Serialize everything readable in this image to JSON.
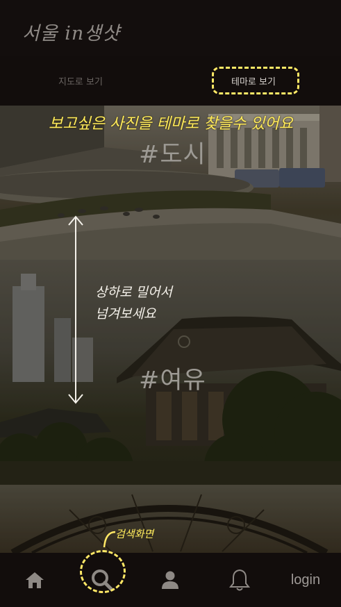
{
  "header": {
    "title": "서울 in생샷"
  },
  "tabs": [
    {
      "label": "지도로 보기",
      "active": false
    },
    {
      "label": "테마로 보기",
      "active": true
    }
  ],
  "themes": [
    {
      "hashtag": "#도시"
    },
    {
      "hashtag": "#여유"
    },
    {
      "hashtag": ""
    }
  ],
  "annotations": {
    "theme_help": "보고싶은 사진을 테마로 찾을수 있어요",
    "swipe_line1": "상하로 밀어서",
    "swipe_line2": "넘겨보세요",
    "search_label": "검색화면"
  },
  "bottom_nav": {
    "home_icon": "home-icon",
    "search_icon": "search-icon",
    "profile_icon": "person-icon",
    "alert_icon": "bell-icon",
    "login_label": "login"
  },
  "colors": {
    "highlight": "#ffe866",
    "bar_background": "#120d0c",
    "active_tab_text": "#d7d2ce",
    "inactive_tab_text": "#6a6562"
  }
}
